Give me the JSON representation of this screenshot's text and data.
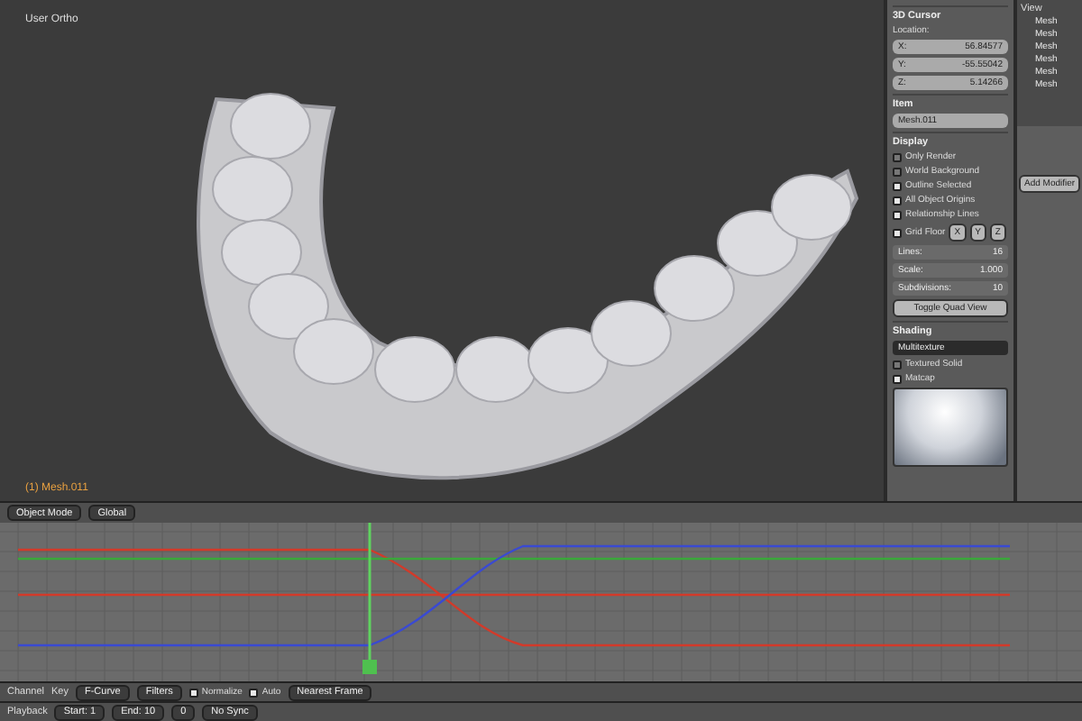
{
  "viewport": {
    "view_name": "User Ortho",
    "object_label": "(1) Mesh.011"
  },
  "properties": {
    "cursor": {
      "title": "3D Cursor",
      "location_label": "Location:",
      "fields": [
        {
          "axis": "X:",
          "value": "56.84577"
        },
        {
          "axis": "Y:",
          "value": "-55.55042"
        },
        {
          "axis": "Z:",
          "value": "5.14266"
        }
      ]
    },
    "item": {
      "title": "Item",
      "name": "Mesh.011"
    },
    "display": {
      "title": "Display",
      "options": [
        {
          "label": "Only Render",
          "checked": false
        },
        {
          "label": "World Background",
          "checked": false
        },
        {
          "label": "Outline Selected",
          "checked": true
        },
        {
          "label": "All Object Origins",
          "checked": true
        },
        {
          "label": "Relationship Lines",
          "checked": true
        }
      ],
      "grid": {
        "label": "Grid Floor",
        "checked": true,
        "axes": [
          "X",
          "Y",
          "Z"
        ],
        "fields": [
          {
            "label": "Lines:",
            "value": "16"
          },
          {
            "label": "Scale:",
            "value": "1.000"
          },
          {
            "label": "Subdivisions:",
            "value": "10"
          }
        ]
      },
      "toggle_button": "Toggle Quad View"
    },
    "shading": {
      "title": "Shading",
      "mode": "Multitexture",
      "options": [
        {
          "label": "Textured Solid",
          "checked": false
        },
        {
          "label": "Matcap",
          "checked": true
        }
      ]
    }
  },
  "outliner": {
    "header": "View",
    "items": [
      "Mesh",
      "Mesh",
      "Mesh",
      "Mesh",
      "Mesh",
      "Mesh"
    ]
  },
  "modifiers": {
    "add_button": "Add Modifier"
  },
  "viewport_header": {
    "mode": "Object Mode",
    "orientation": "Global"
  },
  "graph_header": {
    "menus": [
      "Channel",
      "Key"
    ],
    "mode": "F-Curve",
    "filters": "Filters",
    "normalize": {
      "label": "Normalize",
      "checked": true
    },
    "auto": {
      "label": "Auto",
      "checked": true
    },
    "snap": "Nearest Frame"
  },
  "timeline": {
    "menu": "Playback",
    "start": {
      "label": "Start:",
      "value": "1"
    },
    "end": {
      "label": "End:",
      "value": "10"
    },
    "current": "0",
    "sync": "No Sync"
  }
}
